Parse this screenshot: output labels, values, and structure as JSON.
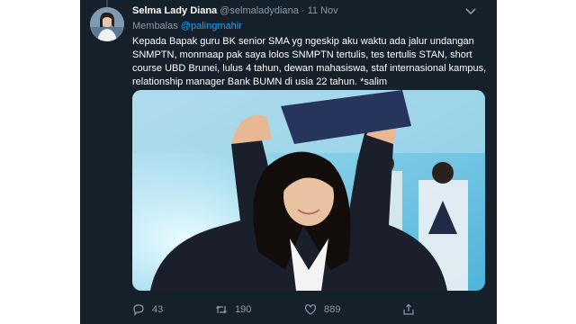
{
  "tweet": {
    "author_name": "Selma Lady Diana",
    "author_handle": "@selmaladydiana",
    "separator": "·",
    "date": "11 Nov",
    "reply_prefix": "Membalas ",
    "reply_mention": "@palingmahir",
    "text": "Kepada Bapak guru BK senior SMA yg ngeskip aku waktu ada jalur undangan SNMPTN, monmaap pak saya lolos SNMPTN tertulis, tes tertulis STAN, short course UBD Brunei, lulus 4 tahun, dewan mahasiswa, staf internasional kampus, relationship manager Bank BUMN di usia 22 tahun. *salim"
  },
  "actions": {
    "reply_count": "43",
    "retweet_count": "190",
    "like_count": "889"
  },
  "icons": {
    "more": "chevron-down-icon",
    "reply": "reply-icon",
    "retweet": "retweet-icon",
    "like": "heart-icon",
    "share": "share-icon"
  },
  "colors": {
    "background": "#15202b",
    "text": "#ffffff",
    "secondary": "#8899a6",
    "link": "#1da1f2"
  }
}
